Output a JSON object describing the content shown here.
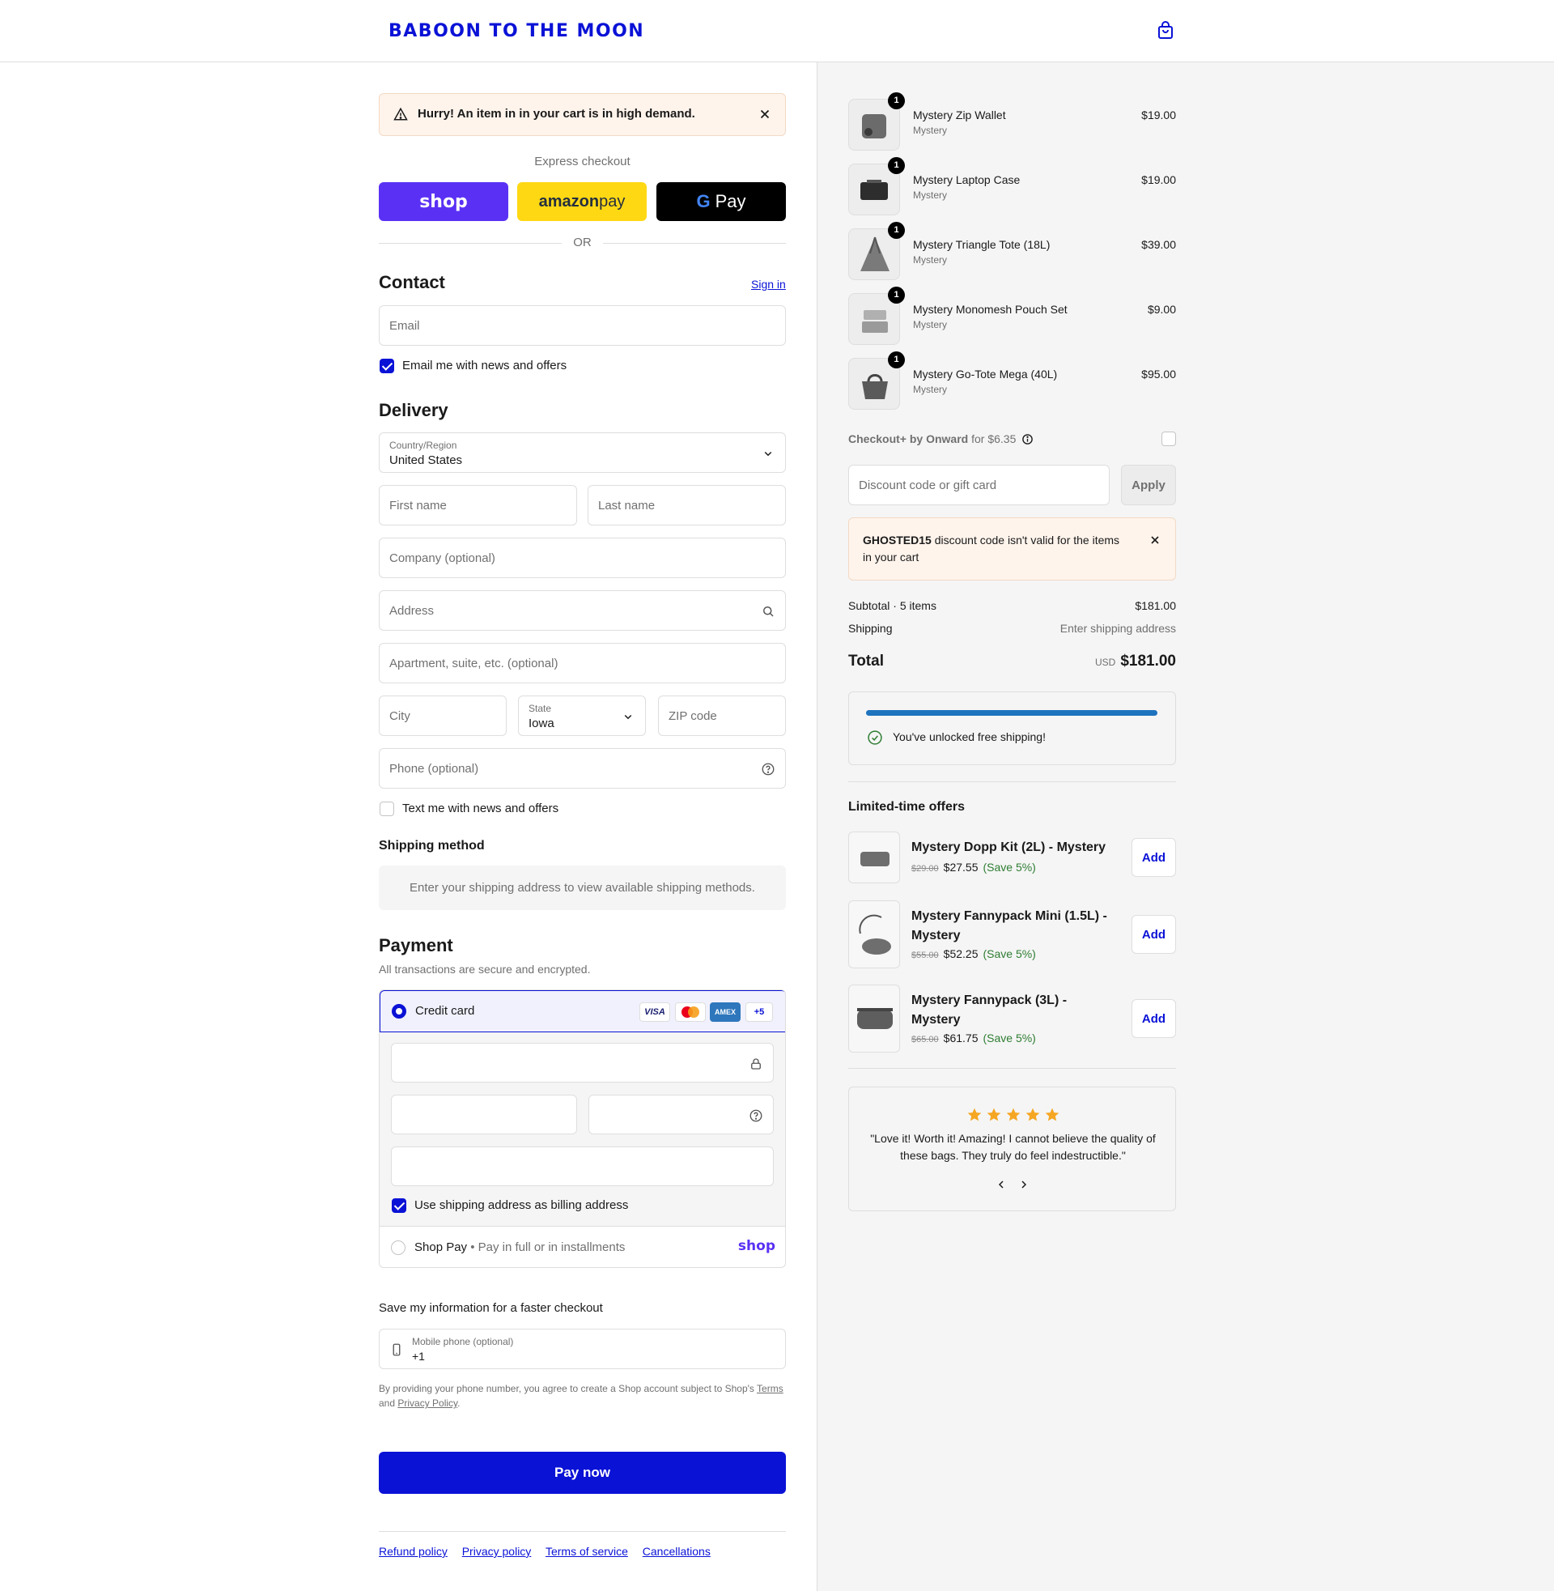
{
  "header": {
    "brand": "BABOON TO THE MOON",
    "cart_icon": "shopping-bag-icon"
  },
  "banner": {
    "text": "Hurry! An item in in your cart is in high demand.",
    "warn_icon": "warning-icon",
    "close_icon": "close-icon"
  },
  "express": {
    "label": "Express checkout",
    "shop_label": "shop",
    "amazon_label_a": "amazon",
    "amazon_label_b": " pay",
    "gpay_g": "G",
    "gpay_label": "Pay",
    "or_label": "OR"
  },
  "contact": {
    "title": "Contact",
    "sign_in": "Sign in",
    "email_placeholder": "Email",
    "news_label": "Email me with news and offers",
    "news_checked": true
  },
  "delivery": {
    "title": "Delivery",
    "country_label": "Country/Region",
    "country_value": "United States",
    "first_name": "First name",
    "last_name": "Last name",
    "company": "Company (optional)",
    "address": "Address",
    "apartment": "Apartment, suite, etc. (optional)",
    "city": "City",
    "state_label": "State",
    "state_value": "Iowa",
    "zip": "ZIP code",
    "phone": "Phone (optional)",
    "text_label": "Text me with news and offers",
    "text_checked": false
  },
  "shipping_method": {
    "title": "Shipping method",
    "message": "Enter your shipping address to view available shipping methods."
  },
  "payment": {
    "title": "Payment",
    "subtitle": "All transactions are secure and encrypted.",
    "credit_card_label": "Credit card",
    "cards": [
      "VISA",
      "MC",
      "AMEX",
      "+5"
    ],
    "billing_label": "Use shipping address as billing address",
    "billing_checked": true,
    "shop_pay_label": "Shop Pay",
    "shop_pay_sub": "Pay in full or in installments",
    "shop_pay_logo": "shop"
  },
  "save_info": {
    "title": "Save my information for a faster checkout",
    "phone_label": "Mobile phone (optional)",
    "phone_value": "+1",
    "legal_a": "By providing your phone number, you agree to create a Shop account subject to Shop's ",
    "legal_terms": "Terms",
    "legal_and": "and ",
    "legal_privacy": "Privacy Policy",
    "legal_end": "."
  },
  "pay_now": "Pay now",
  "footer_links": [
    "Refund policy",
    "Privacy policy",
    "Terms of service",
    "Cancellations"
  ],
  "cart": {
    "items": [
      {
        "qty": "1",
        "name": "Mystery Zip Wallet",
        "variant": "Mystery",
        "price": "$19.00"
      },
      {
        "qty": "1",
        "name": "Mystery Laptop Case",
        "variant": "Mystery",
        "price": "$19.00"
      },
      {
        "qty": "1",
        "name": "Mystery Triangle Tote (18L)",
        "variant": "Mystery",
        "price": "$39.00"
      },
      {
        "qty": "1",
        "name": "Mystery Monomesh Pouch Set",
        "variant": "Mystery",
        "price": "$9.00"
      },
      {
        "qty": "1",
        "name": "Mystery Go-Tote Mega (40L)",
        "variant": "Mystery",
        "price": "$95.00"
      }
    ],
    "checkout_plus": "Checkout+ by Onward",
    "checkout_plus_price": "for $6.35",
    "discount_placeholder": "Discount code or gift card",
    "apply": "Apply",
    "discount_error_code": "GHOSTED15",
    "discount_error_rest": " discount code isn't valid for the items in your cart",
    "subtotal_label": "Subtotal · 5 items",
    "subtotal_value": "$181.00",
    "shipping_label": "Shipping",
    "shipping_value": "Enter shipping address",
    "total_label": "Total",
    "total_currency": "USD",
    "total_value": "$181.00",
    "free_shipping_progress": 1.0,
    "free_shipping_text": "You've unlocked free shipping!"
  },
  "offers": {
    "title": "Limited-time offers",
    "items": [
      {
        "title": "Mystery Dopp Kit (2L) - Mystery",
        "old": "$29.00",
        "new": "$27.55",
        "save": "(Save 5%)",
        "add": "Add"
      },
      {
        "title": "Mystery Fannypack Mini (1.5L) - Mystery",
        "old": "$55.00",
        "new": "$52.25",
        "save": "(Save 5%)",
        "add": "Add"
      },
      {
        "title": "Mystery Fannypack (3L) - Mystery",
        "old": "$65.00",
        "new": "$61.75",
        "save": "(Save 5%)",
        "add": "Add"
      }
    ]
  },
  "review": {
    "stars": 5,
    "text": "\"Love it! Worth it! Amazing! I cannot believe the quality of these bags. They truly do feel indestructible.\"",
    "star_color": "#f5a623"
  },
  "colors": {
    "accent": "#0a12d6",
    "shop_purple": "#5a31f4",
    "amazon_yellow": "#ffd814",
    "progress_blue": "#1e73be"
  }
}
